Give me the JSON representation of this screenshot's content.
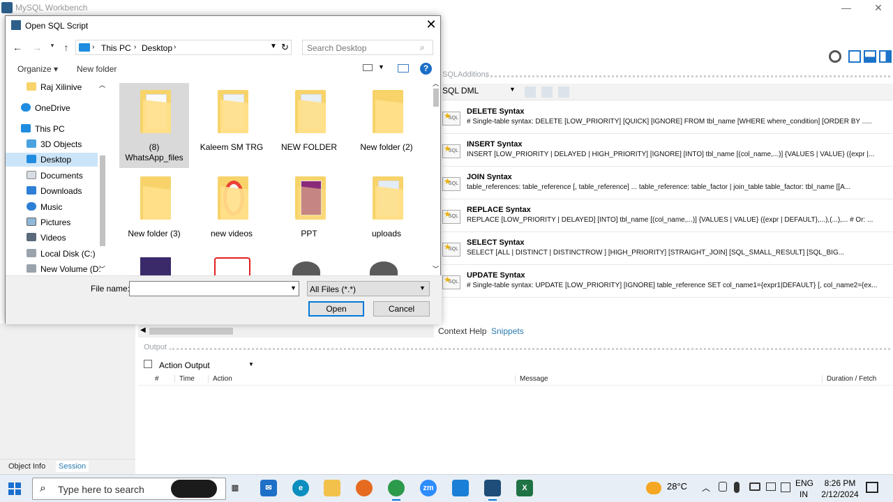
{
  "app": {
    "title": "MySQL Workbench"
  },
  "sql_additions": {
    "header": "SQLAdditions",
    "selector": "SQL DML",
    "snippets": [
      {
        "title": "DELETE Syntax",
        "body": "# Single-table syntax: DELETE [LOW_PRIORITY] [QUICK] [IGNORE] FROM tbl_name    [WHERE where_condition]    [ORDER BY ....."
      },
      {
        "title": "INSERT Syntax",
        "body": "INSERT [LOW_PRIORITY | DELAYED | HIGH_PRIORITY] [IGNORE]    [INTO] tbl_name [(col_name,...)]    {VALUES | VALUE} ({expr |..."
      },
      {
        "title": "JOIN Syntax",
        "body": "table_references:    table_reference [, table_reference] ... table_reference:    table_factor  | join_table table_factor:    tbl_name [[A..."
      },
      {
        "title": "REPLACE Syntax",
        "body": "REPLACE [LOW_PRIORITY | DELAYED]    [INTO] tbl_name [(col_name,...)]    {VALUES | VALUE} ({expr | DEFAULT},...),(...),... # Or: ..."
      },
      {
        "title": "SELECT Syntax",
        "body": "SELECT    [ALL | DISTINCT | DISTINCTROW ]    [HIGH_PRIORITY]    [STRAIGHT_JOIN]    [SQL_SMALL_RESULT] [SQL_BIG..."
      },
      {
        "title": "UPDATE Syntax",
        "body": "# Single-table syntax: UPDATE [LOW_PRIORITY] [IGNORE] table_reference    SET col_name1={expr1|DEFAULT} [, col_name2={ex..."
      }
    ]
  },
  "side_tabs": {
    "context_help": "Context Help",
    "snippets": "Snippets"
  },
  "output": {
    "header": "Output",
    "mode": "Action Output",
    "columns": [
      "#",
      "Time",
      "Action",
      "Message",
      "Duration / Fetch"
    ]
  },
  "left_tabs": {
    "object_info": "Object Info",
    "session": "Session"
  },
  "dialog": {
    "title": "Open SQL Script",
    "breadcrumb": [
      "This PC",
      "Desktop"
    ],
    "search_placeholder": "Search Desktop",
    "organize": "Organize",
    "new_folder": "New folder",
    "nav_items": [
      {
        "label": "Raj Xilinive",
        "icon": "folder-icon",
        "indent": 1
      },
      {
        "label": "OneDrive",
        "icon": "cloud-icon",
        "indent": 0
      },
      {
        "label": "This PC",
        "icon": "computer-icon",
        "indent": 0
      },
      {
        "label": "3D Objects",
        "icon": "cube-icon",
        "indent": 1
      },
      {
        "label": "Desktop",
        "icon": "desktop-icon",
        "indent": 1,
        "selected": true
      },
      {
        "label": "Documents",
        "icon": "document-icon",
        "indent": 1
      },
      {
        "label": "Downloads",
        "icon": "download-icon",
        "indent": 1
      },
      {
        "label": "Music",
        "icon": "music-icon",
        "indent": 1
      },
      {
        "label": "Pictures",
        "icon": "pictures-icon",
        "indent": 1
      },
      {
        "label": "Videos",
        "icon": "video-icon",
        "indent": 1
      },
      {
        "label": "Local Disk (C:)",
        "icon": "disk-icon",
        "indent": 1
      },
      {
        "label": "New Volume (D:",
        "icon": "disk-icon",
        "indent": 1
      }
    ],
    "files": [
      {
        "label": "(8) WhatsApp_files",
        "selected": true
      },
      {
        "label": "Kaleem SM TRG"
      },
      {
        "label": "NEW FOLDER"
      },
      {
        "label": "New folder (2)"
      },
      {
        "label": "New folder (3)"
      },
      {
        "label": "new videos"
      },
      {
        "label": "PPT"
      },
      {
        "label": "uploads"
      }
    ],
    "file_name_label": "File name:",
    "file_name_value": "",
    "filter": "All Files (*.*)",
    "open": "Open",
    "cancel": "Cancel"
  },
  "taskbar": {
    "search_placeholder": "Type here to search",
    "temperature": "28°C",
    "lang": [
      "ENG",
      "IN"
    ],
    "time": "8:26 PM",
    "date": "2/12/2024"
  }
}
